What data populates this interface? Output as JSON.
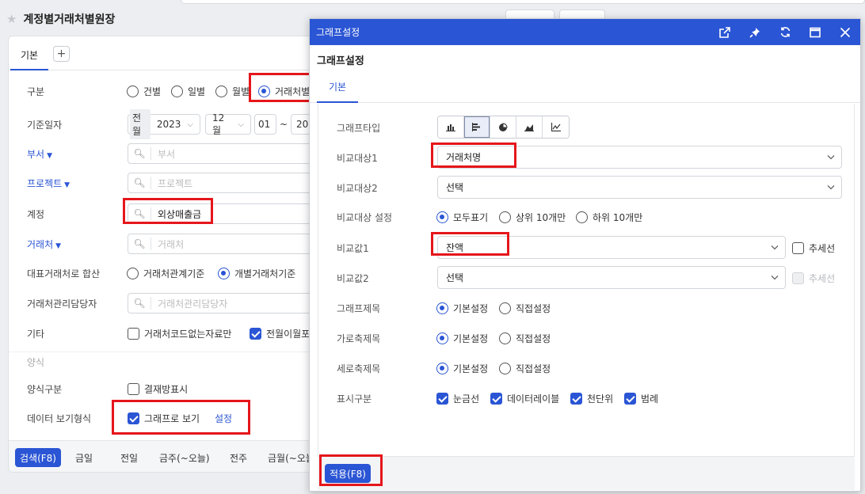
{
  "page": {
    "title": "계정별거래처별원장",
    "tab_basic": "기본",
    "tab_add": "+",
    "rows": {
      "category": {
        "label": "구분",
        "options": [
          "건별",
          "일별",
          "월별",
          "거래처별"
        ],
        "selected_index": 3
      },
      "base_date": {
        "label": "기준일자",
        "period_prefix": "전월",
        "year": "2023",
        "month": "12월",
        "from_day": "01",
        "tilde": "~",
        "to_day": "20"
      },
      "department": {
        "label": "부서",
        "placeholder": "부서"
      },
      "project": {
        "label": "프로젝트",
        "placeholder": "프로젝트"
      },
      "account": {
        "label": "계정",
        "value": "외상매출금"
      },
      "vendor": {
        "label": "거래처",
        "placeholder": "거래처"
      },
      "rep_vendor": {
        "label": "대표거래처로 합산",
        "options": [
          "거래처관계기준",
          "개별거래처기준"
        ],
        "selected_index": 1
      },
      "vendor_manager": {
        "label": "거래처관리담당자",
        "placeholder": "거래처관리담당자"
      },
      "etc": {
        "label": "기타",
        "options": [
          "거래처코드없는자료만",
          "전월이월포함"
        ],
        "checked": [
          false,
          true
        ]
      },
      "section": "양식",
      "form_type": {
        "label": "양식구분",
        "option": "결재방표시",
        "checked": false
      },
      "data_view": {
        "label": "데이터 보기형식",
        "option": "그래프로 보기",
        "checked": true,
        "link": "설정"
      }
    },
    "footer": {
      "search": "검색(F8)",
      "quick": [
        "금일",
        "전일",
        "금주(~오늘)",
        "전주",
        "금월(~오늘)"
      ]
    }
  },
  "modal": {
    "title": "그래프설정",
    "subtitle": "그래프설정",
    "header_icons": [
      "external-link-icon",
      "pin-icon",
      "refresh-icon",
      "maximize-icon",
      "close-icon"
    ],
    "tab": "기본",
    "fields": {
      "chart_type": {
        "label": "그래프타입",
        "types": [
          "bar-chart",
          "horizontal-bar-chart",
          "pie-chart",
          "area-chart",
          "line-chart"
        ],
        "selected_index": 1
      },
      "compare1": {
        "label": "비교대상1",
        "value": "거래처명"
      },
      "compare2": {
        "label": "비교대상2",
        "value": "선택"
      },
      "compare_display": {
        "label": "비교대상 설정",
        "options": [
          "모두표기",
          "상위 10개만",
          "하위 10개만"
        ],
        "selected_index": 0
      },
      "value1": {
        "label": "비교값1",
        "value": "잔액",
        "trend_label": "추세선",
        "trend_checked": false
      },
      "value2": {
        "label": "비교값2",
        "value": "선택",
        "trend_label": "추세선",
        "trend_disabled": true
      },
      "graph_title": {
        "label": "그래프제목",
        "options": [
          "기본설정",
          "직접설정"
        ],
        "selected_index": 0
      },
      "x_title": {
        "label": "가로축제목",
        "options": [
          "기본설정",
          "직접설정"
        ],
        "selected_index": 0
      },
      "y_title": {
        "label": "세로축제목",
        "options": [
          "기본설정",
          "직접설정"
        ],
        "selected_index": 0
      },
      "display": {
        "label": "표시구분",
        "options": [
          "눈금선",
          "데이터레이블",
          "천단위",
          "범례"
        ],
        "checked": [
          true,
          true,
          true,
          true
        ]
      }
    },
    "apply": "적용(F8)"
  },
  "colors": {
    "accent": "#2a55d4",
    "highlight": "#e5161b"
  }
}
